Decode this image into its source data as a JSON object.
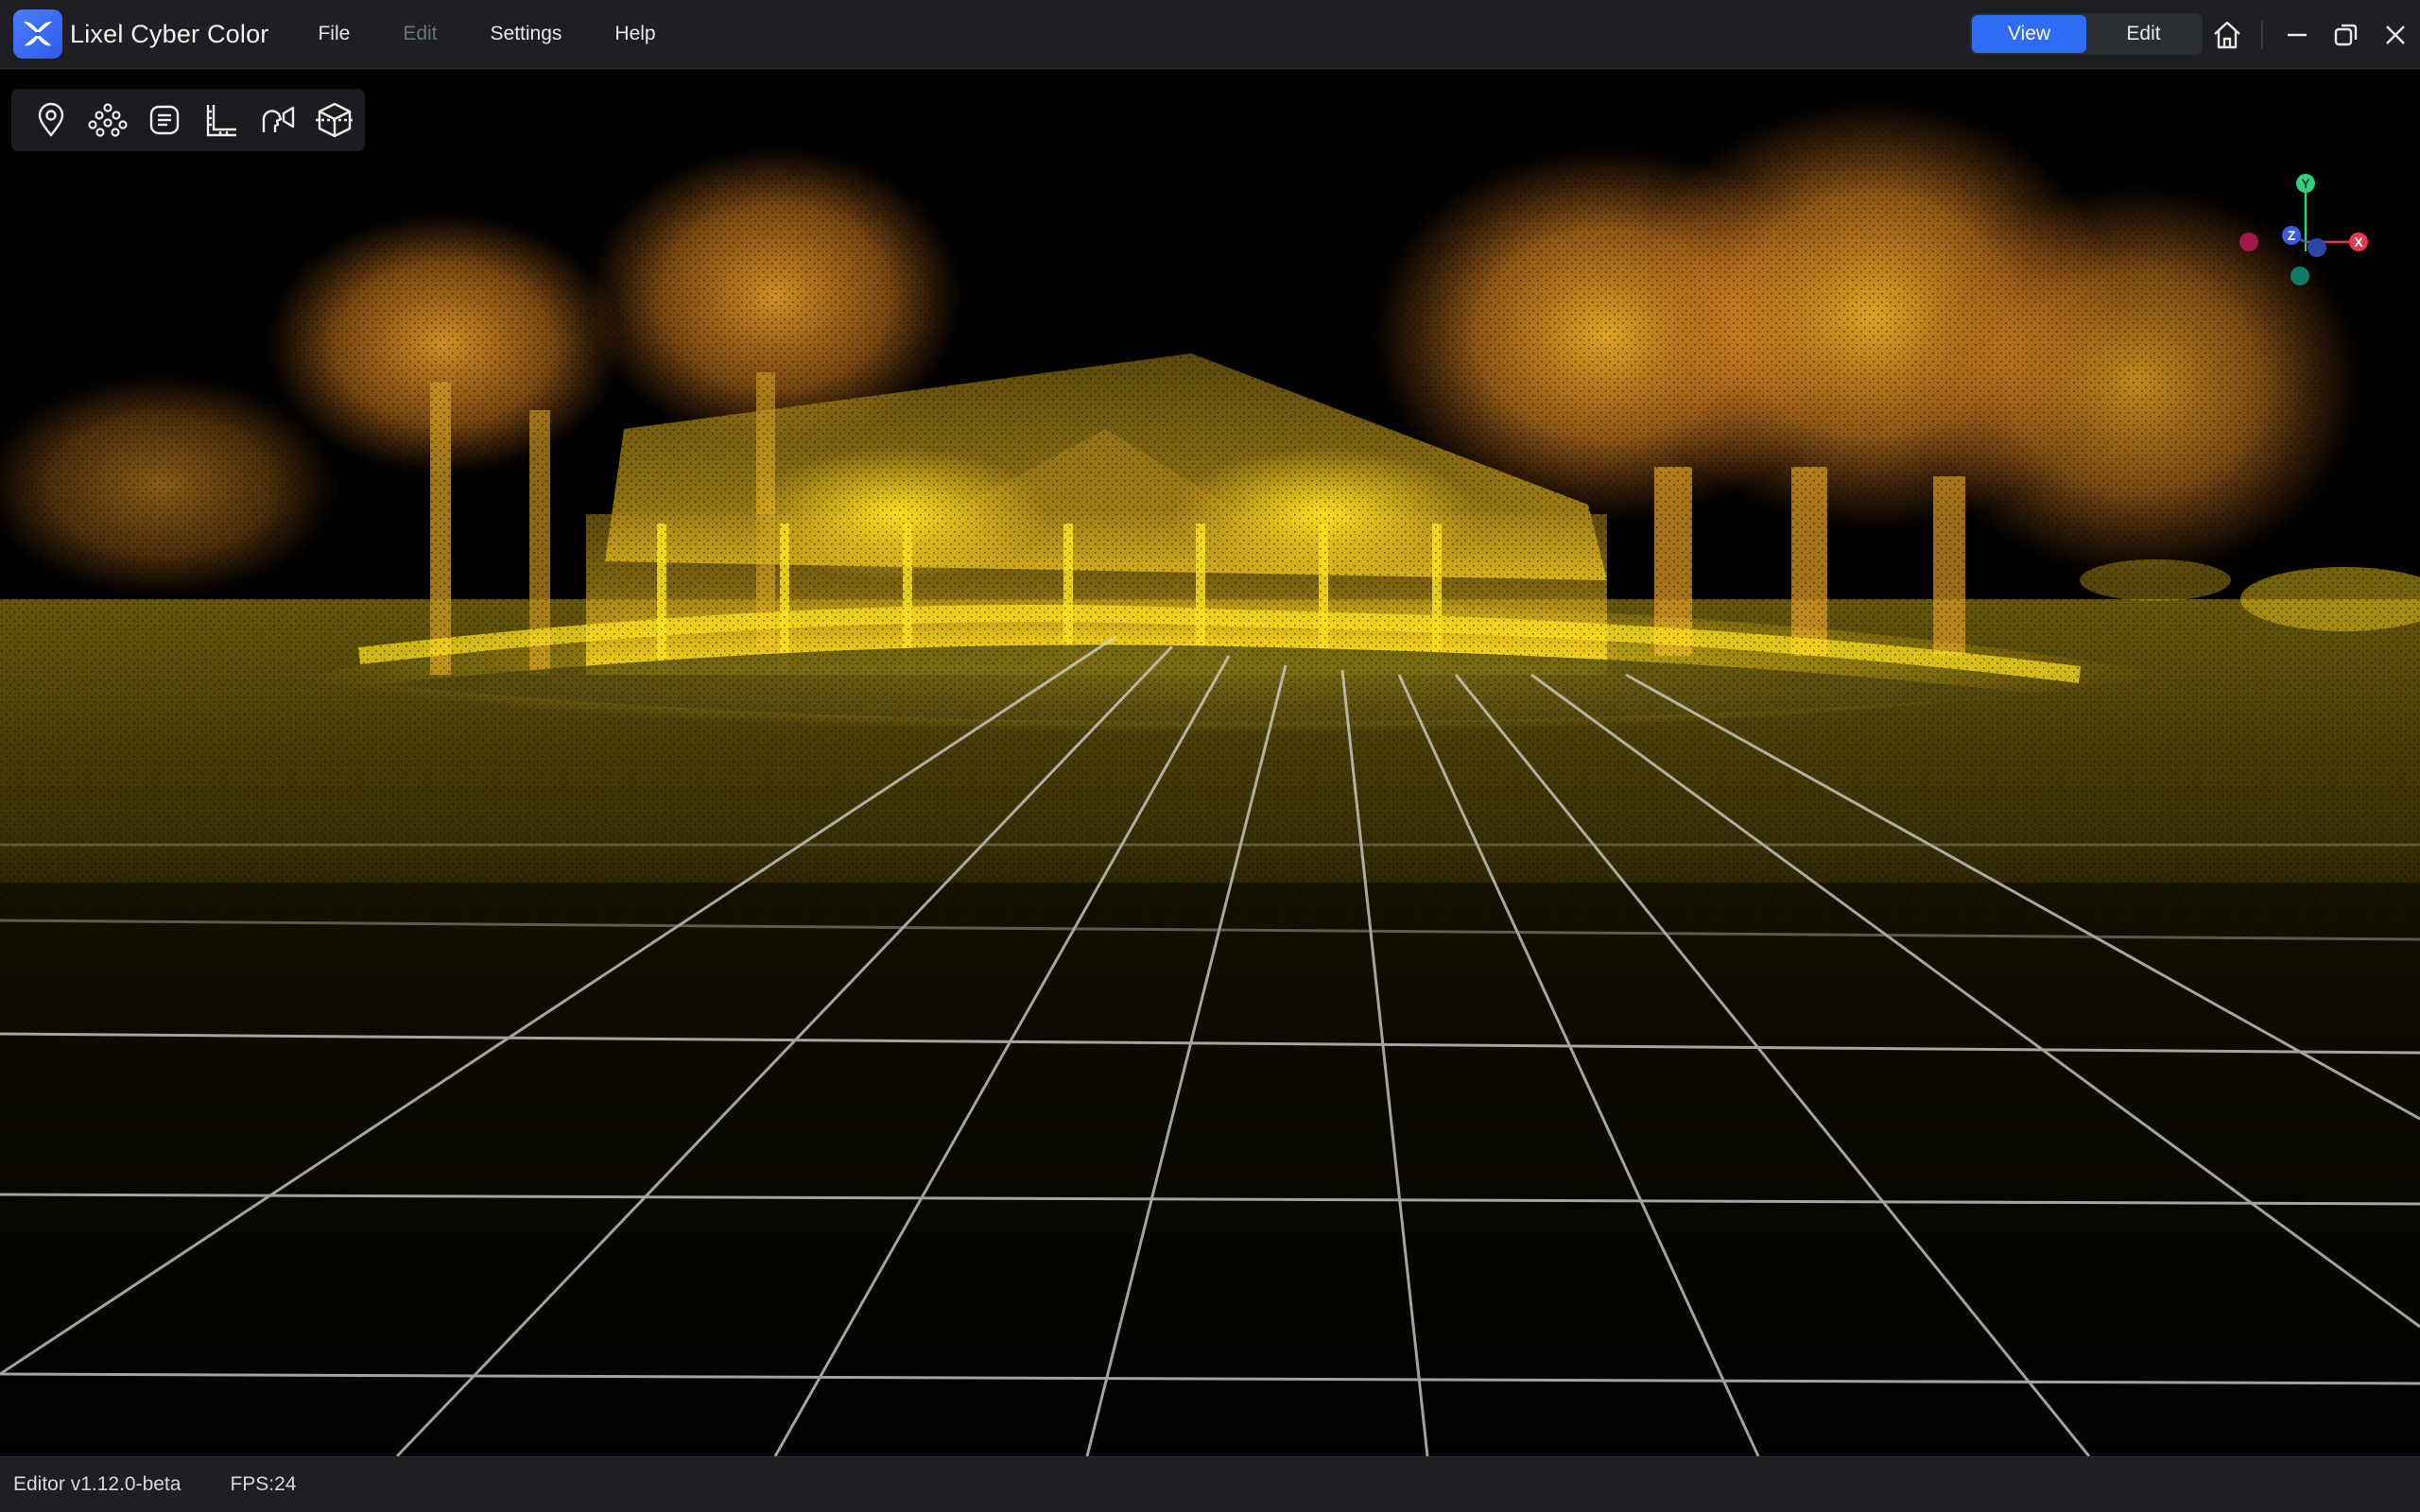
{
  "app": {
    "title": "Lixel Cyber Color",
    "logo_icon": "butterfly-logo-icon"
  },
  "menu": {
    "items": [
      {
        "label": "File",
        "enabled": true
      },
      {
        "label": "Edit",
        "enabled": false
      },
      {
        "label": "Settings",
        "enabled": true
      },
      {
        "label": "Help",
        "enabled": true
      }
    ]
  },
  "mode_switch": {
    "view_label": "View",
    "edit_label": "Edit",
    "active": "View",
    "accent": "#2f6cf5"
  },
  "window_controls": [
    "home-icon",
    "minimize-icon",
    "restore-icon",
    "close-icon"
  ],
  "toolbox": {
    "tools": [
      "location-pin-icon",
      "point-cloud-icon",
      "list-icon",
      "ruler-icon",
      "voice-guide-icon",
      "cube-icon"
    ]
  },
  "gizmo": {
    "x_label": "X",
    "y_label": "Y",
    "z_label": "Z",
    "x_color": "#e8384f",
    "y_color": "#2fd27a",
    "z_color": "#3b5bdb"
  },
  "status": {
    "version": "Editor v1.12.0-beta",
    "fps": "FPS:24"
  },
  "scene": {
    "type": "point-cloud",
    "colors": [
      "#ffe01a",
      "#f5b51d",
      "#f08a2a",
      "#c96a22"
    ]
  }
}
